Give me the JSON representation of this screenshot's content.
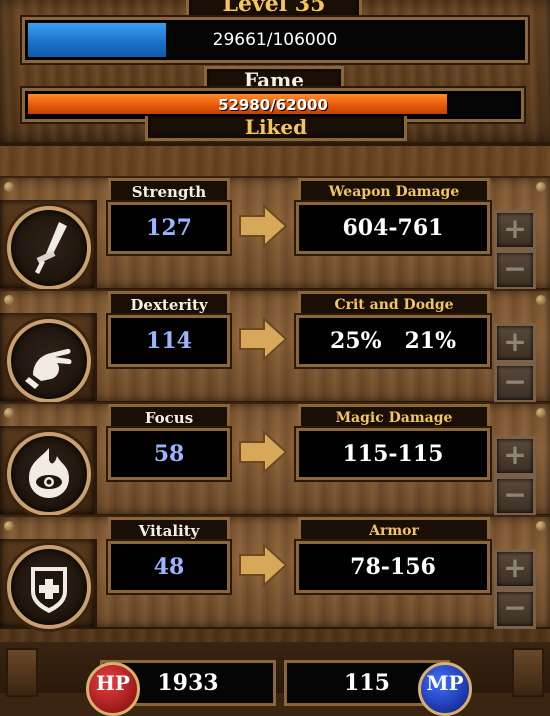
{
  "header": {
    "level_label": "Level 35",
    "xp_text": "29661/106000",
    "xp_fraction": 0.2798,
    "fame_title": "Fame",
    "fame_text": "52980/62000",
    "fame_fraction": 0.8545,
    "fame_rank": "Liked",
    "xp_color": "#2a88e0",
    "fame_color": "#e8550a"
  },
  "stats": [
    {
      "label": "Strength",
      "value": "127",
      "derived_label": "Weapon Damage",
      "derived_value": "604-761",
      "icon": "sword-icon"
    },
    {
      "label": "Dexterity",
      "value": "114",
      "derived_label": "Crit and Dodge",
      "derived_value": "25%   21%",
      "icon": "hand-icon"
    },
    {
      "label": "Focus",
      "value": "58",
      "derived_label": "Magic Damage",
      "derived_value": "115-115",
      "icon": "eye-flame-icon"
    },
    {
      "label": "Vitality",
      "value": "48",
      "derived_label": "Armor",
      "derived_value": "78-156",
      "icon": "shield-cross-icon"
    }
  ],
  "buttons": {
    "plus": "+",
    "minus": "−"
  },
  "footer": {
    "hp_label": "HP",
    "hp_value": "1933",
    "mp_label": "MP",
    "mp_value": "115",
    "hp_color": "#c81e1e",
    "mp_color": "#1e3ec8"
  }
}
